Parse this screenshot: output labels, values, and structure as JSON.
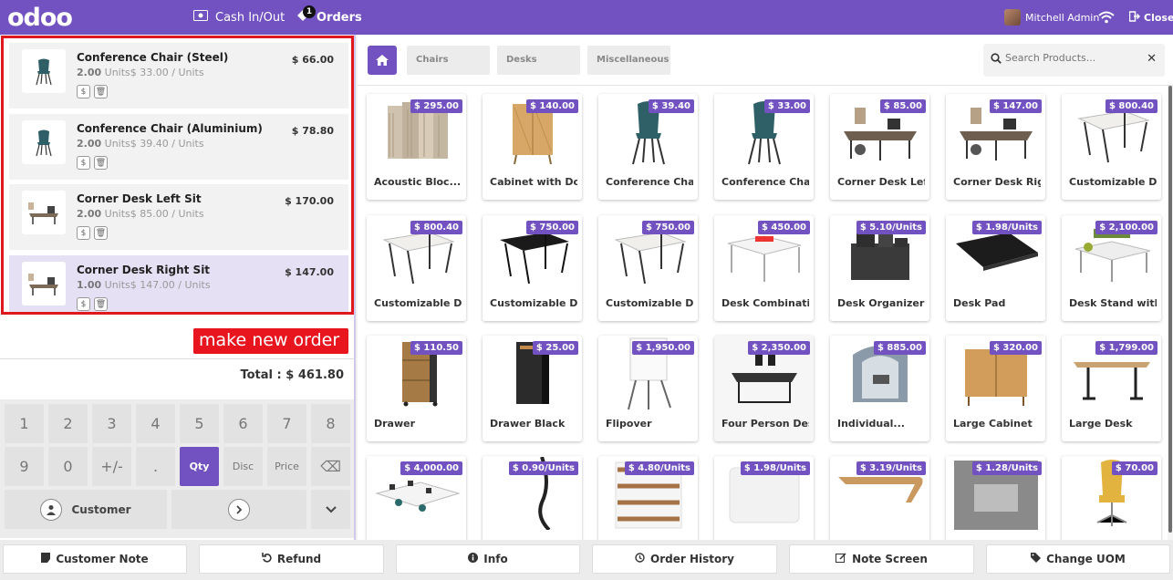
{
  "navbar": {
    "logo": "odoo",
    "cash_label": "Cash In/Out",
    "orders_label": "Orders",
    "orders_badge": "1",
    "user_name": "Mitchell Admin",
    "close_label": "Close"
  },
  "orderlines": [
    {
      "name": "Conference Chair (Steel)",
      "qty": "2.00",
      "unit_price": "Units$ 33.00 / Units",
      "price": "$ 66.00",
      "icon": "chair-icon"
    },
    {
      "name": "Conference Chair (Aluminium)",
      "qty": "2.00",
      "unit_price": "Units$ 39.40 / Units",
      "price": "$ 78.80",
      "icon": "chair-icon"
    },
    {
      "name": "Corner Desk Left Sit",
      "qty": "2.00",
      "unit_price": "Units$ 85.00 / Units",
      "price": "$ 170.00",
      "icon": "desk-icon"
    },
    {
      "name": "Corner Desk Right Sit",
      "qty": "1.00",
      "unit_price": "Units$ 147.00 / Units",
      "price": "$ 147.00",
      "icon": "desk-icon"
    }
  ],
  "line_buttons": {
    "price": "$",
    "delete": "🗑"
  },
  "annotation": "make new order",
  "total": "Total : $ 461.80",
  "numpad": {
    "row1": [
      "1",
      "2",
      "3",
      "4",
      "5",
      "6",
      "7",
      "8"
    ],
    "row2": [
      "9",
      "0",
      "+/-",
      ".",
      "Qty",
      "Disc",
      "Price",
      "⌫"
    ],
    "customer": "Customer"
  },
  "categories": [
    "Chairs",
    "Desks",
    "Miscellaneous"
  ],
  "search": {
    "placeholder": "Search Products..."
  },
  "products": [
    {
      "name": "Acoustic Bloc...",
      "price": "$ 295.00",
      "img": "screens"
    },
    {
      "name": "Cabinet with Doors",
      "price": "$ 140.00",
      "img": "cabinet"
    },
    {
      "name": "Conference Chair...",
      "price": "$ 39.40",
      "img": "chair"
    },
    {
      "name": "Conference Chair...",
      "price": "$ 33.00",
      "img": "chair"
    },
    {
      "name": "Corner Desk Left...",
      "price": "$ 85.00",
      "img": "cornerdesk"
    },
    {
      "name": "Corner Desk Right...",
      "price": "$ 147.00",
      "img": "cornerdesk"
    },
    {
      "name": "Customizable Des...",
      "price": "$ 800.40",
      "img": "deskwhite"
    },
    {
      "name": "Customizable Des...",
      "price": "$ 800.40",
      "img": "deskwhite"
    },
    {
      "name": "Customizable Des...",
      "price": "$ 750.00",
      "img": "deskblack"
    },
    {
      "name": "Customizable Des...",
      "price": "$ 750.00",
      "img": "deskwhite"
    },
    {
      "name": "Desk Combination",
      "price": "$ 450.00",
      "img": "deskcombo"
    },
    {
      "name": "Desk Organizer",
      "price": "$ 5.10/Units",
      "img": "organizer"
    },
    {
      "name": "Desk Pad",
      "price": "$ 1.98/Units",
      "img": "deskpad"
    },
    {
      "name": "Desk Stand with...",
      "price": "$ 2,100.00",
      "img": "deskstand"
    },
    {
      "name": "Drawer",
      "price": "$ 110.50",
      "img": "drawer"
    },
    {
      "name": "Drawer Black",
      "price": "$ 25.00",
      "img": "drawerblack"
    },
    {
      "name": "Flipover",
      "price": "$ 1,950.00",
      "img": "flipover"
    },
    {
      "name": "Four Person Desk",
      "price": "$ 2,350.00",
      "img": "fourdesk"
    },
    {
      "name": "Individual...",
      "price": "$ 885.00",
      "img": "booth"
    },
    {
      "name": "Large Cabinet",
      "price": "$ 320.00",
      "img": "largecabinet"
    },
    {
      "name": "Large Desk",
      "price": "$ 1,799.00",
      "img": "largedesk"
    },
    {
      "name": "",
      "price": "$ 4,000.00",
      "img": "openspace"
    },
    {
      "name": "",
      "price": "$ 0.90/Units",
      "img": "cable"
    },
    {
      "name": "",
      "price": "$ 4.80/Units",
      "img": "shelves"
    },
    {
      "name": "",
      "price": "$ 1.98/Units",
      "img": "mat"
    },
    {
      "name": "",
      "price": "$ 3.19/Units",
      "img": "monitorstand"
    },
    {
      "name": "",
      "price": "$ 1.28/Units",
      "img": "grey"
    },
    {
      "name": "",
      "price": "$ 70.00",
      "img": "officechair"
    }
  ],
  "bottom_buttons": [
    {
      "label": "Customer Note",
      "icon": "note-icon"
    },
    {
      "label": "Refund",
      "icon": "undo-icon"
    },
    {
      "label": "Info",
      "icon": "info-icon"
    },
    {
      "label": "Order History",
      "icon": "history-icon"
    },
    {
      "label": "Note Screen",
      "icon": "edit-icon"
    },
    {
      "label": "Change UOM",
      "icon": "tag-icon"
    }
  ],
  "colors": {
    "primary": "#7152c0",
    "highlight_border": "#e0171d",
    "annotation_bg": "#e8141e"
  }
}
